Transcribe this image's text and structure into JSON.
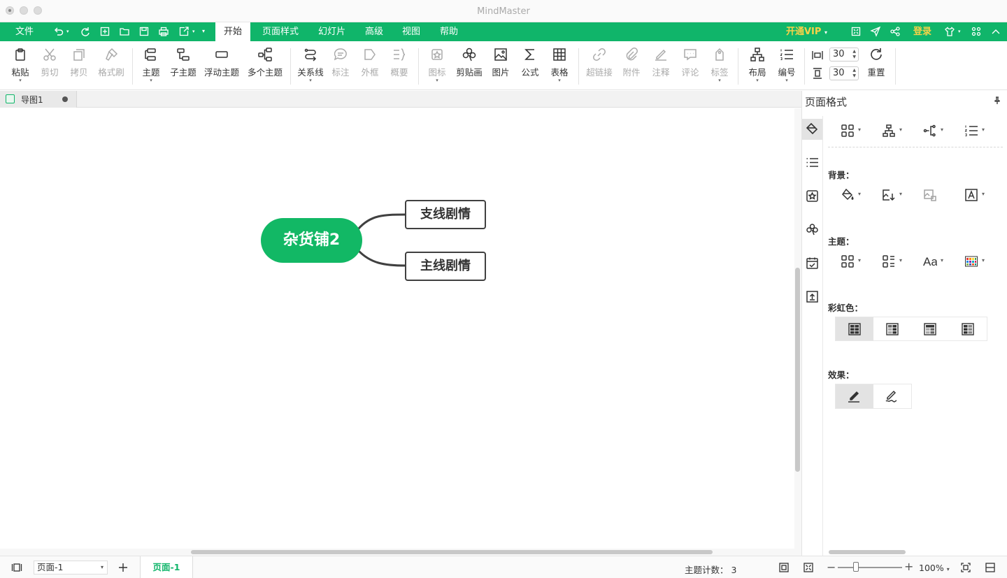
{
  "window": {
    "title": "MindMaster"
  },
  "menu": {
    "file": "文件",
    "tabs": [
      "开始",
      "页面样式",
      "幻灯片",
      "高级",
      "视图",
      "帮助"
    ],
    "vip": "开通VIP",
    "login": "登录"
  },
  "ribbon": {
    "paste": "粘贴",
    "cut": "剪切",
    "copy": "拷贝",
    "format_painter": "格式刷",
    "topic": "主题",
    "subtopic": "子主题",
    "floating_topic": "浮动主题",
    "multi_topic": "多个主题",
    "relationship": "关系线",
    "callout": "标注",
    "boundary": "外框",
    "summary": "概要",
    "icon": "图标",
    "clipart": "剪贴画",
    "picture": "图片",
    "formula": "公式",
    "table": "表格",
    "hyperlink": "超链接",
    "attachment": "附件",
    "note": "注释",
    "comment": "评论",
    "tag": "标签",
    "layout": "布局",
    "numbering": "编号",
    "h_spacing": "30",
    "v_spacing": "30",
    "reset": "重置"
  },
  "document": {
    "tab_name": "导图1"
  },
  "mindmap": {
    "root": "杂货铺2",
    "children": [
      "支线剧情",
      "主线剧情"
    ],
    "root_color": "#12b865"
  },
  "panel": {
    "title": "页面格式",
    "background_label": "背景：",
    "theme_label": "主题：",
    "rainbow_label": "彩虹色：",
    "effect_label": "效果："
  },
  "status": {
    "page_select": "页面-1",
    "active_page": "页面-1",
    "topic_count_label": "主题计数：",
    "topic_count": "3",
    "zoom": "100%"
  },
  "colors": {
    "accent": "#10b56a",
    "vip": "#f8d248"
  }
}
